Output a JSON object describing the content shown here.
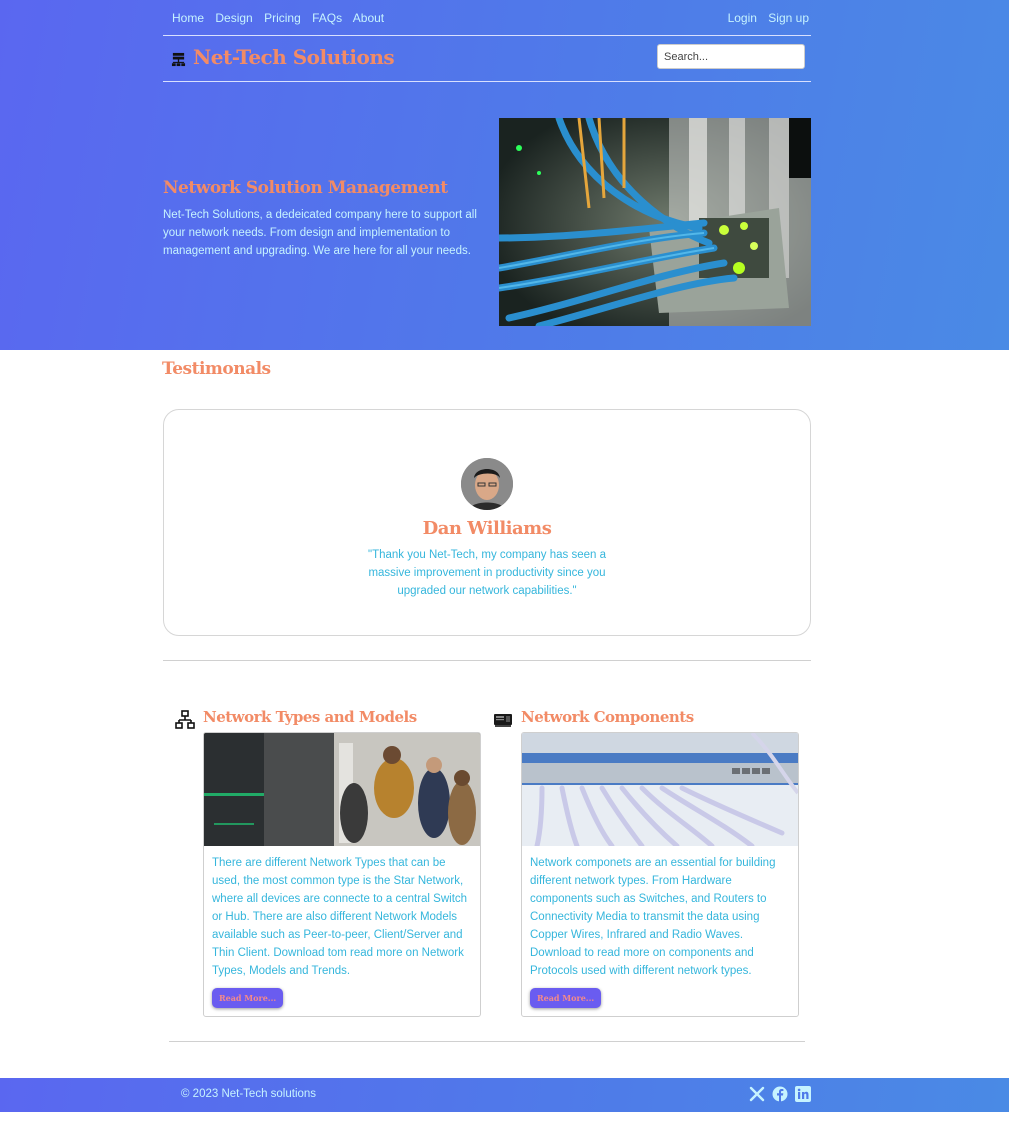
{
  "nav": {
    "links": [
      "Home",
      "Design",
      "Pricing",
      "FAQs",
      "About"
    ],
    "auth": [
      "Login",
      "Sign up"
    ]
  },
  "brand": {
    "icon": "network-server-icon",
    "name": "Net-Tech Solutions"
  },
  "search": {
    "placeholder": "Search..."
  },
  "hero": {
    "title": "Network Solution Management",
    "text": "Net-Tech Solutions, a dedeicated company here to support all your network needs. From design and implementation to management and upgrading. We are here for all your needs."
  },
  "testimonials": {
    "title": "Testimonals",
    "name": "Dan Williams",
    "quote": "\"Thank you Net-Tech, my company has seen a massive improvement in productivity since you upgraded our network capabilities.\""
  },
  "cards": [
    {
      "icon": "network-diagram-icon",
      "title": "Network Types and Models",
      "text": "There are different Network Types that can be used, the most common type is the Star Network, where all devices are connecte to a central Switch or Hub. There are also different Network Models available such as Peer-to-peer, Client/Server and Thin Client. Download tom read more on Network Types, Models and Trends.",
      "button": "Read More..."
    },
    {
      "icon": "network-card-icon",
      "title": "Network Components",
      "text": "Network componets are an essential for building different network types. From Hardware components such as Switches, and Routers to Connectivity Media to transmit the data using Copper Wires, Infrared and Radio Waves. Download to read more on components and Protocols used with different network types.",
      "button": "Read More..."
    }
  ],
  "footer": {
    "copyright": "© 2023 Net-Tech solutions",
    "social": [
      "x-icon",
      "facebook-icon",
      "linkedin-icon"
    ]
  },
  "colors": {
    "accent": "#f28b66",
    "link": "#c6f3ff",
    "body_text": "#35b6dc",
    "gradient_start": "#5a67f0",
    "gradient_end": "#4a8ae5",
    "button": "#6a5cf0"
  }
}
